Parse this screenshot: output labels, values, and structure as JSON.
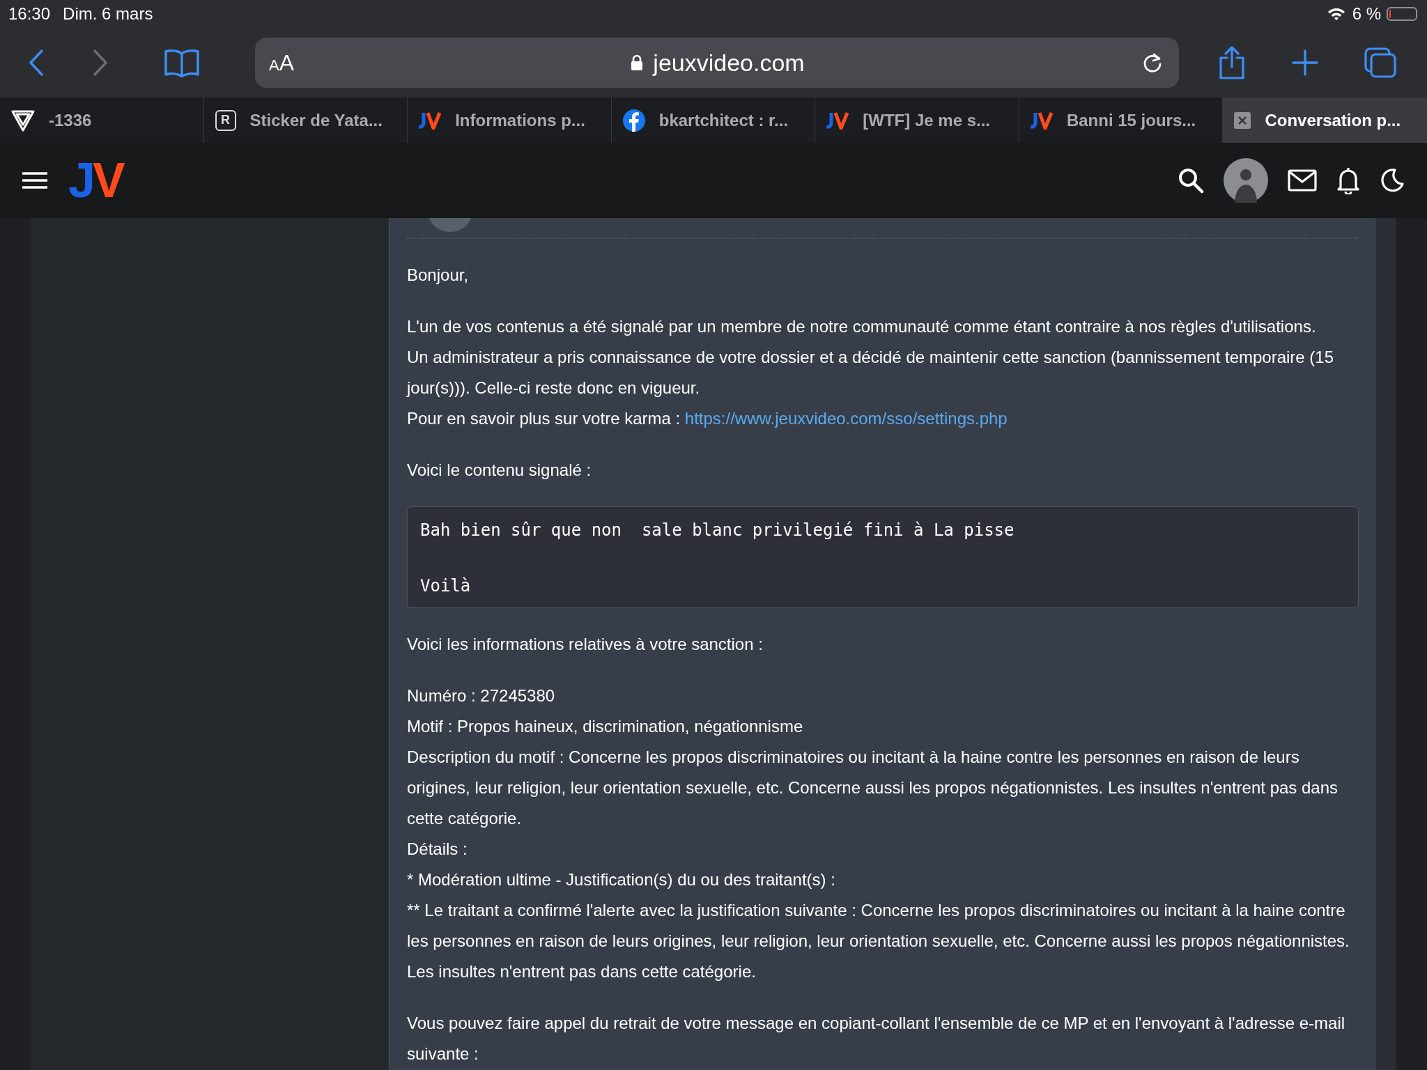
{
  "status_bar": {
    "time": "16:30",
    "date": "Dim. 6 mars",
    "battery": "6 %"
  },
  "toolbar": {
    "text_size": [
      "A",
      "A"
    ],
    "address": "jeuxvideo.com"
  },
  "tabs": [
    {
      "label": "-1336",
      "kind": "triangle",
      "selected": false
    },
    {
      "label": "Sticker de Yata...",
      "kind": "letter",
      "icon_text": "R",
      "selected": false
    },
    {
      "label": "Informations p...",
      "kind": "jv",
      "selected": false
    },
    {
      "label": "bkartchitect : r...",
      "kind": "facebook",
      "selected": false
    },
    {
      "label": "[WTF] Je me s...",
      "kind": "jv",
      "selected": false
    },
    {
      "label": "Banni 15 jours...",
      "kind": "jv",
      "selected": false
    },
    {
      "label": "Conversation p...",
      "kind": "close",
      "selected": true
    }
  ],
  "site_header": {
    "logo": [
      "J",
      "V"
    ]
  },
  "message": [
    {
      "kind": "text",
      "lines": [
        {
          "text": "Bonjour,"
        }
      ]
    },
    {
      "kind": "text",
      "lines": [
        {
          "text": "L'un de vos contenus a été signalé par un membre de notre communauté comme étant contraire à nos règles d'utilisations."
        },
        {
          "text": "Un administrateur a pris connaissance de votre dossier et a décidé de maintenir cette sanction (bannissement temporaire (15 jour(s))). Celle-ci reste donc en vigueur."
        },
        {
          "text": "Pour en savoir plus sur votre karma : ",
          "link": "https://www.jeuxvideo.com/sso/settings.php"
        }
      ]
    },
    {
      "kind": "text",
      "lines": [
        {
          "text": "Voici le contenu signalé :"
        }
      ]
    },
    {
      "kind": "code",
      "lines": [
        "Bah bien sûr que non  sale blanc privilegié fini à La pisse",
        "Voilà"
      ]
    },
    {
      "kind": "text",
      "lines": [
        {
          "text": "Voici les informations relatives à votre sanction :"
        }
      ]
    },
    {
      "kind": "text",
      "lines": [
        {
          "text": "Numéro : 27245380"
        },
        {
          "text": "Motif : Propos haineux, discrimination, négationnisme"
        },
        {
          "text": "Description du motif : Concerne les propos discriminatoires ou incitant à la haine contre les personnes en raison de leurs origines, leur religion, leur orientation sexuelle, etc. Concerne aussi les propos négationnistes. Les insultes n'entrent pas dans cette catégorie."
        },
        {
          "text": "Détails :"
        },
        {
          "text": "* Modération ultime - Justification(s) du ou des traitant(s) :"
        },
        {
          "text": "** Le traitant a confirmé l'alerte avec la justification suivante : Concerne les propos discriminatoires ou incitant à la haine contre les personnes en raison de leurs origines, leur religion, leur orientation sexuelle, etc. Concerne aussi les propos négationnistes. Les insultes n'entrent pas dans cette catégorie."
        }
      ]
    },
    {
      "kind": "text",
      "lines": [
        {
          "text": "Vous pouvez faire appel du retrait de votre message en copiant-collant l'ensemble de ce MP et en l'envoyant à l'adresse e-mail suivante :"
        }
      ]
    }
  ]
}
